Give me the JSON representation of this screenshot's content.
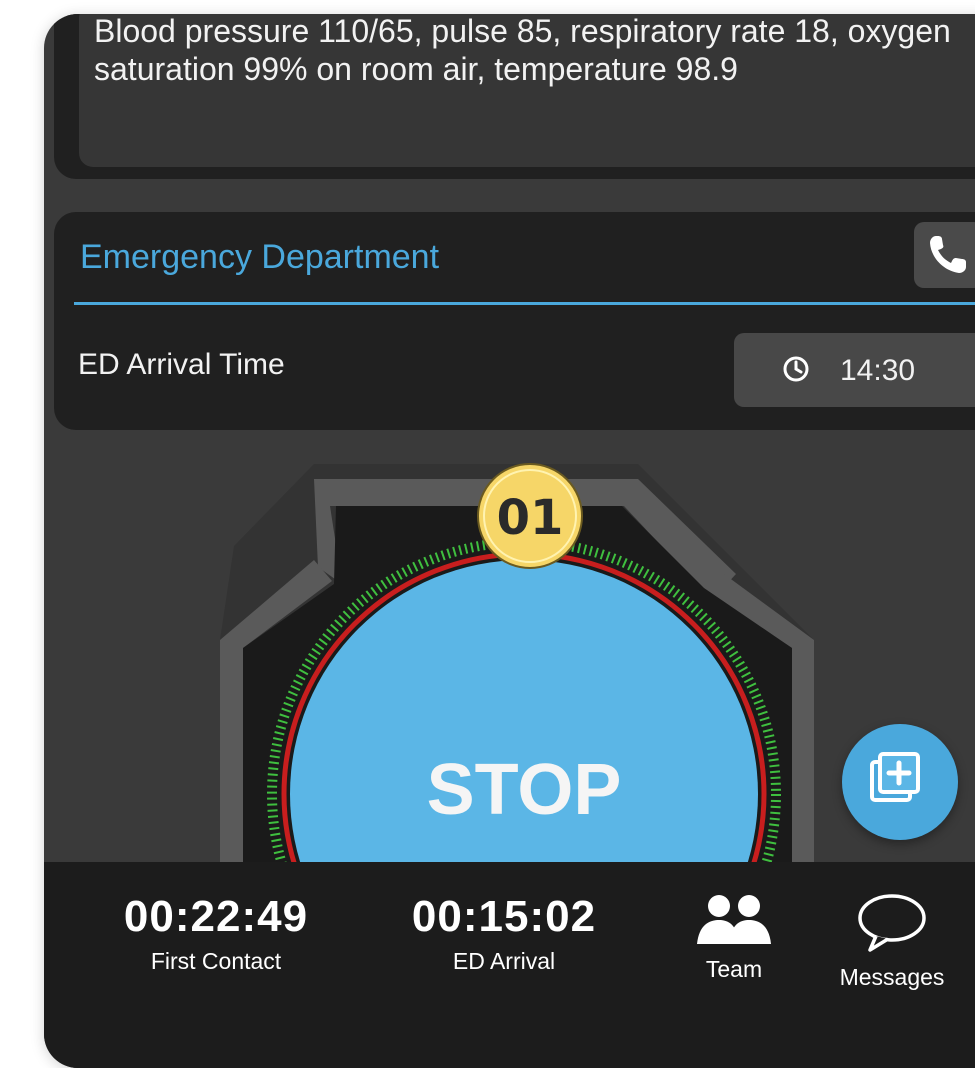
{
  "vitals": {
    "text": "Blood pressure 110/65, pulse 85, respiratory rate 18, oxygen saturation 99% on room air, temperature 98.9"
  },
  "ed_section": {
    "title": "Emergency Department",
    "arrival_label": "ED Arrival Time",
    "arrival_time": "14:30"
  },
  "timer": {
    "badge": "01",
    "stop_label": "STOP"
  },
  "bottom_bar": {
    "first_contact_time": "00:22:49",
    "first_contact_label": "First Contact",
    "ed_arrival_time": "00:15:02",
    "ed_arrival_label": "ED Arrival",
    "team_label": "Team",
    "messages_label": "Messages"
  },
  "colors": {
    "accent_blue": "#4aa8dc",
    "stop_blue": "#5bb6e6",
    "badge_yellow": "#f6d668",
    "tick_green": "#3fbf3f",
    "tick_red": "#c81e1e",
    "bar_bg": "#1c1c1c"
  }
}
